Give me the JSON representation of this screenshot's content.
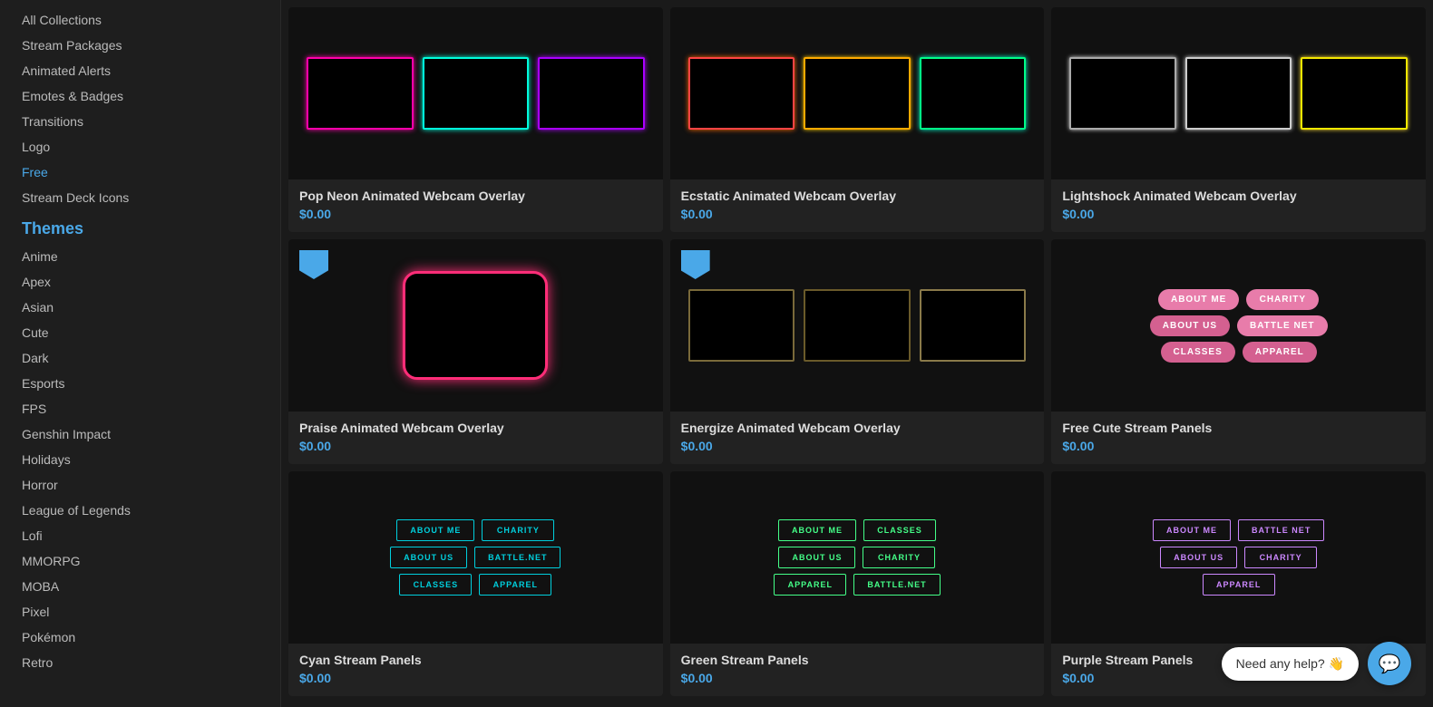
{
  "sidebar": {
    "menu_items": [
      {
        "label": "All Collections",
        "active": false
      },
      {
        "label": "Stream Packages",
        "active": false
      },
      {
        "label": "Animated Alerts",
        "active": false
      },
      {
        "label": "Emotes & Badges",
        "active": false
      },
      {
        "label": "Transitions",
        "active": false
      },
      {
        "label": "Logo",
        "active": false
      },
      {
        "label": "Free",
        "active": true
      },
      {
        "label": "Stream Deck Icons",
        "active": false
      }
    ],
    "themes_title": "Themes",
    "themes": [
      {
        "label": "Anime"
      },
      {
        "label": "Apex"
      },
      {
        "label": "Asian"
      },
      {
        "label": "Cute"
      },
      {
        "label": "Dark"
      },
      {
        "label": "Esports"
      },
      {
        "label": "FPS"
      },
      {
        "label": "Genshin Impact"
      },
      {
        "label": "Holidays"
      },
      {
        "label": "Horror"
      },
      {
        "label": "League of Legends"
      },
      {
        "label": "Lofi"
      },
      {
        "label": "MMORPG"
      },
      {
        "label": "MOBA"
      },
      {
        "label": "Pixel"
      },
      {
        "label": "Pokémon"
      },
      {
        "label": "Retro"
      }
    ]
  },
  "products": [
    {
      "id": "pop-neon",
      "title": "Pop Neon Animated Webcam Overlay",
      "price": "$0.00",
      "badge": false,
      "type": "neon-webcam"
    },
    {
      "id": "ecstatic",
      "title": "Ecstatic Animated Webcam Overlay",
      "price": "$0.00",
      "badge": false,
      "type": "ecstatic-webcam"
    },
    {
      "id": "lightshock",
      "title": "Lightshock Animated Webcam Overlay",
      "price": "$0.00",
      "badge": false,
      "type": "light-webcam"
    },
    {
      "id": "praise",
      "title": "Praise Animated Webcam Overlay",
      "price": "$0.00",
      "badge": true,
      "type": "praise-webcam"
    },
    {
      "id": "energize",
      "title": "Energize Animated Webcam Overlay",
      "price": "$0.00",
      "badge": true,
      "type": "energize-webcam"
    },
    {
      "id": "free-cute",
      "title": "Free Cute Stream Panels",
      "price": "$0.00",
      "badge": false,
      "type": "cute-panels"
    },
    {
      "id": "cyan-panels",
      "title": "Cyan Stream Panels",
      "price": "$0.00",
      "badge": false,
      "type": "cyan-panels"
    },
    {
      "id": "green-panels",
      "title": "Green Stream Panels",
      "price": "$0.00",
      "badge": false,
      "type": "green-panels"
    },
    {
      "id": "purple-panels",
      "title": "Purple Stream Panels",
      "price": "$0.00",
      "badge": false,
      "type": "purple-panels"
    }
  ],
  "help": {
    "bubble_text": "Need any help? 👋",
    "btn_icon": "💬"
  }
}
